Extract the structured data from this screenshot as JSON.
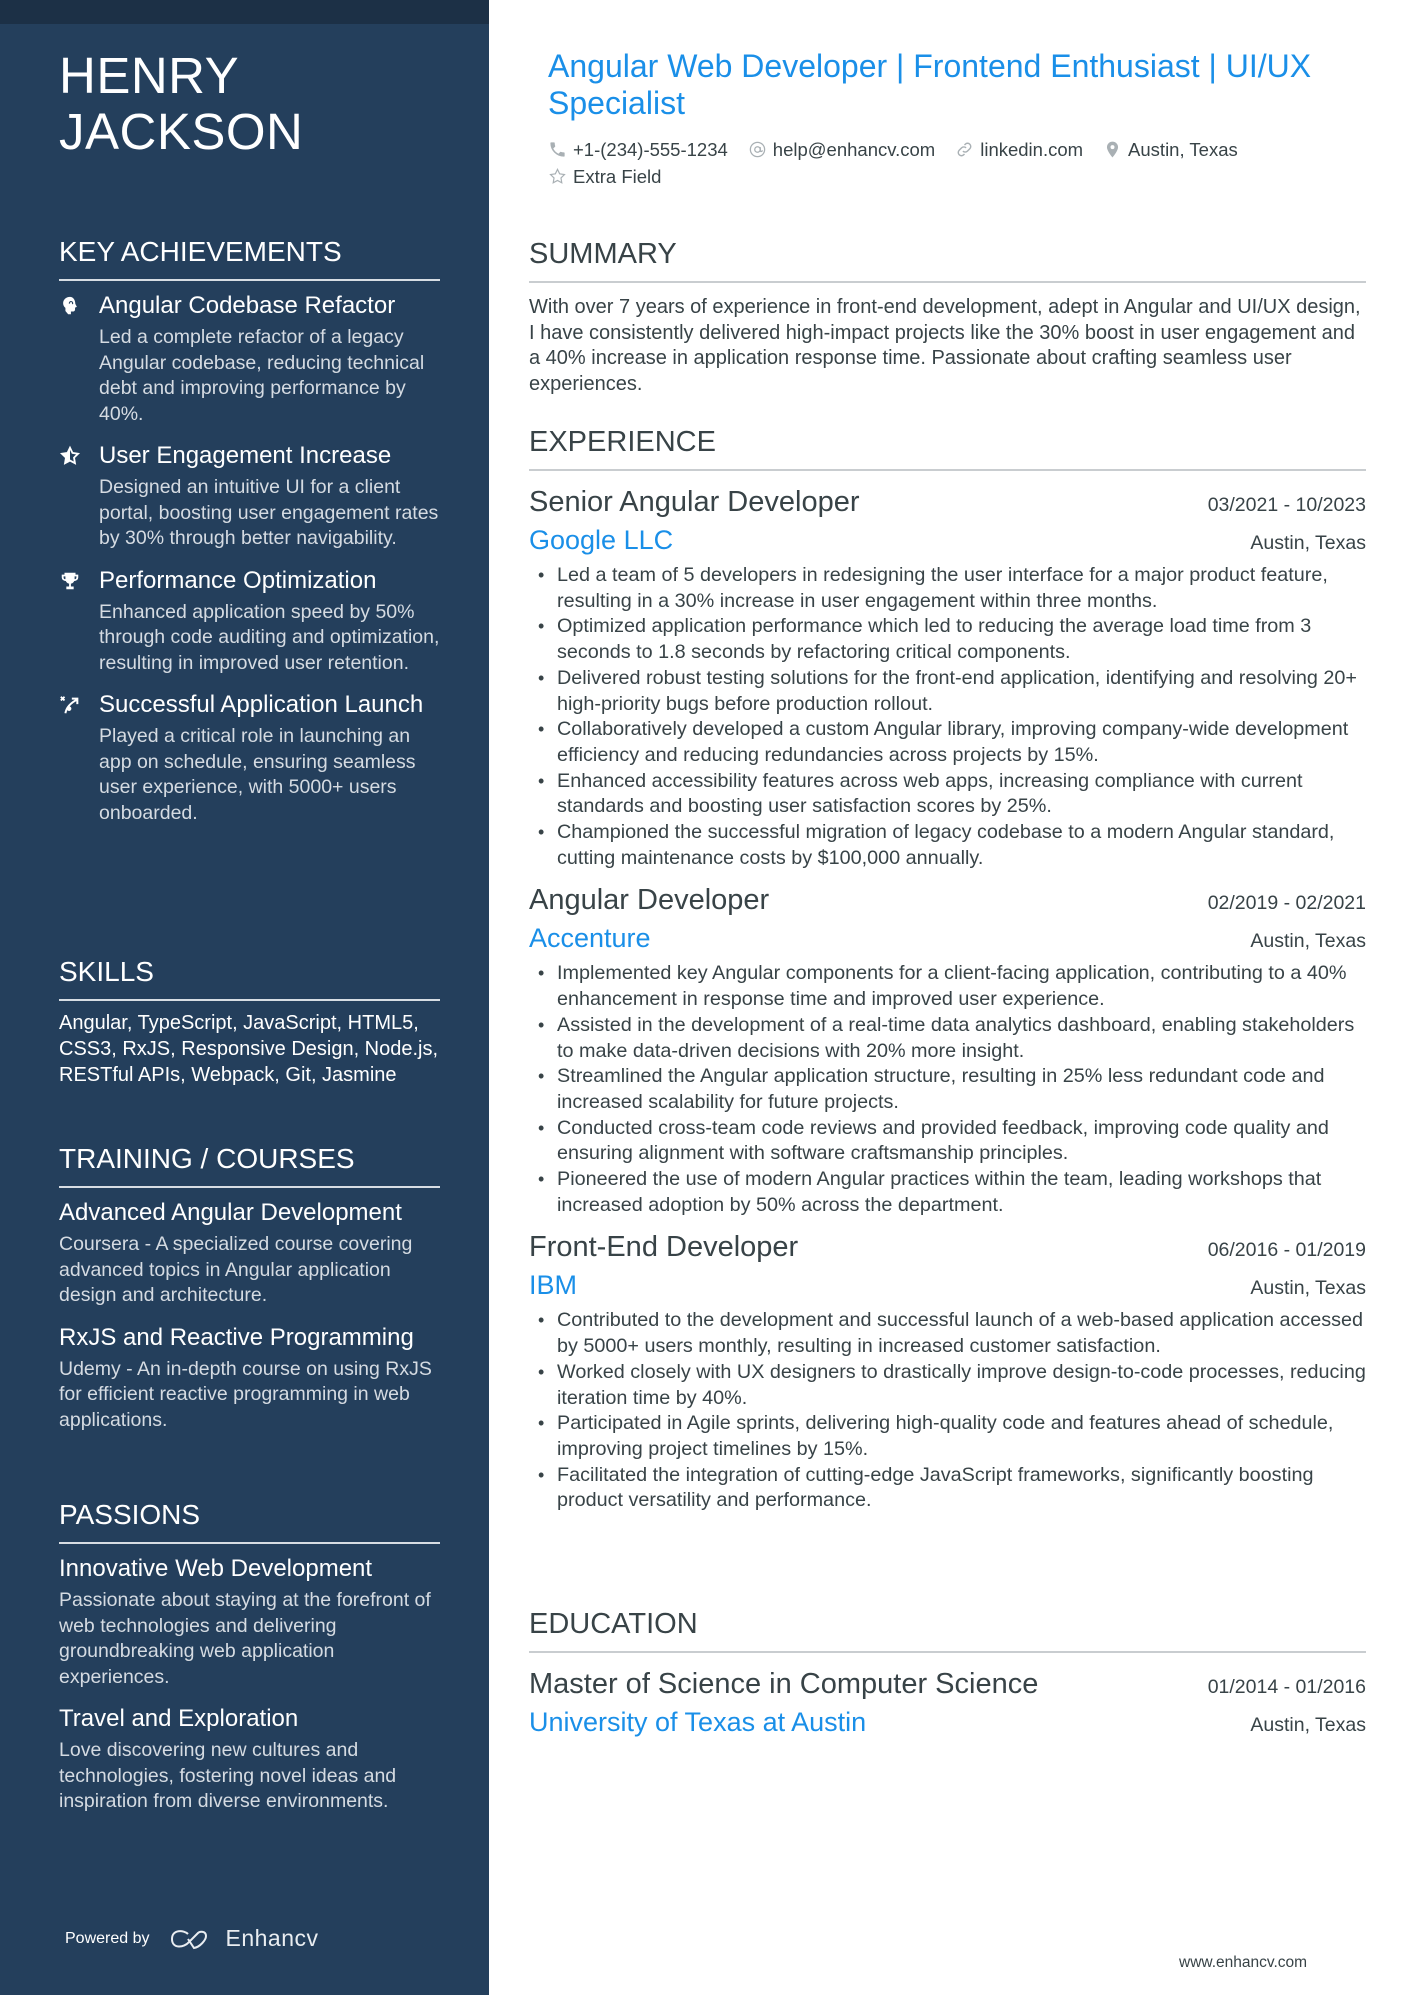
{
  "profile": {
    "first_name": "HENRY",
    "last_name": "JACKSON",
    "headline": "Angular Web Developer | Frontend Enthusiast | UI/UX Specialist",
    "contacts": [
      {
        "icon": "phone-icon",
        "text": "+1-(234)-555-1234"
      },
      {
        "icon": "at-icon",
        "text": "help@enhancv.com"
      },
      {
        "icon": "link-icon",
        "text": "linkedin.com"
      },
      {
        "icon": "location-pin-icon",
        "text": "Austin, Texas"
      }
    ],
    "extra": {
      "icon": "star-outline-icon",
      "text": "Extra Field"
    }
  },
  "sidebar": {
    "achievements": {
      "heading": "KEY ACHIEVEMENTS",
      "items": [
        {
          "icon": "head-brain-icon",
          "title": "Angular Codebase Refactor",
          "description": "Led a complete refactor of a legacy Angular codebase, reducing technical debt and improving performance by 40%."
        },
        {
          "icon": "star-half-icon",
          "title": "User Engagement Increase",
          "description": "Designed an intuitive UI for a client portal, boosting user engagement rates by 30% through better navigability."
        },
        {
          "icon": "trophy-icon",
          "title": "Performance Optimization",
          "description": "Enhanced application speed by 50% through code auditing and optimization, resulting in improved user retention."
        },
        {
          "icon": "route-launch-icon",
          "title": "Successful Application Launch",
          "description": "Played a critical role in launching an app on schedule, ensuring seamless user experience, with 5000+ users onboarded."
        }
      ]
    },
    "skills": {
      "heading": "SKILLS",
      "text": "Angular, TypeScript, JavaScript, HTML5, CSS3, RxJS, Responsive Design, Node.js, RESTful APIs, Webpack, Git, Jasmine"
    },
    "training": {
      "heading": "TRAINING / COURSES",
      "items": [
        {
          "title": "Advanced Angular Development",
          "description": "Coursera - A specialized course covering advanced topics in Angular application design and architecture."
        },
        {
          "title": "RxJS and Reactive Programming",
          "description": "Udemy - An in-depth course on using RxJS for efficient reactive programming in web applications."
        }
      ]
    },
    "passions": {
      "heading": "PASSIONS",
      "items": [
        {
          "title": "Innovative Web Development",
          "description": "Passionate about staying at the forefront of web technologies and delivering groundbreaking web application experiences."
        },
        {
          "title": "Travel and Exploration",
          "description": "Love discovering new cultures and technologies, fostering novel ideas and inspiration from diverse environments."
        }
      ]
    },
    "powered_by": {
      "label": "Powered by",
      "brand": "Enhancv"
    }
  },
  "main": {
    "summary": {
      "heading": "SUMMARY",
      "text": "With over 7 years of experience in front-end development, adept in Angular and UI/UX design, I have consistently delivered high-impact projects like the 30% boost in user engagement and a 40% increase in application response time. Passionate about crafting seamless user experiences."
    },
    "experience": {
      "heading": "EXPERIENCE",
      "jobs": [
        {
          "role": "Senior Angular Developer",
          "dates": "03/2021 - 10/2023",
          "company": "Google LLC",
          "location": "Austin, Texas",
          "bullets": [
            "Led a team of 5 developers in redesigning the user interface for a major product feature, resulting in a 30% increase in user engagement within three months.",
            "Optimized application performance which led to reducing the average load time from 3 seconds to 1.8 seconds by refactoring critical components.",
            "Delivered robust testing solutions for the front-end application, identifying and resolving 20+ high-priority bugs before production rollout.",
            "Collaboratively developed a custom Angular library, improving company-wide development efficiency and reducing redundancies across projects by 15%.",
            "Enhanced accessibility features across web apps, increasing compliance with current standards and boosting user satisfaction scores by 25%.",
            "Championed the successful migration of legacy codebase to a modern Angular standard, cutting maintenance costs by $100,000 annually."
          ]
        },
        {
          "role": "Angular Developer",
          "dates": "02/2019 - 02/2021",
          "company": "Accenture",
          "location": "Austin, Texas",
          "bullets": [
            "Implemented key Angular components for a client-facing application, contributing to a 40% enhancement in response time and improved user experience.",
            "Assisted in the development of a real-time data analytics dashboard, enabling stakeholders to make data-driven decisions with 20% more insight.",
            "Streamlined the Angular application structure, resulting in 25% less redundant code and increased scalability for future projects.",
            "Conducted cross-team code reviews and provided feedback, improving code quality and ensuring alignment with software craftsmanship principles.",
            "Pioneered the use of modern Angular practices within the team, leading workshops that increased adoption by 50% across the department."
          ]
        },
        {
          "role": "Front-End Developer",
          "dates": "06/2016 - 01/2019",
          "company": "IBM",
          "location": "Austin, Texas",
          "bullets": [
            "Contributed to the development and successful launch of a web-based application accessed by 5000+ users monthly, resulting in increased customer satisfaction.",
            "Worked closely with UX designers to drastically improve design-to-code processes, reducing iteration time by 40%.",
            "Participated in Agile sprints, delivering high-quality code and features ahead of schedule, improving project timelines by 15%.",
            "Facilitated the integration of cutting-edge JavaScript frameworks, significantly boosting product versatility and performance."
          ]
        }
      ]
    },
    "education": {
      "heading": "EDUCATION",
      "items": [
        {
          "degree": "Master of Science in Computer Science",
          "dates": "01/2014 - 01/2016",
          "school": "University of Texas at Austin",
          "location": "Austin, Texas"
        }
      ]
    }
  },
  "footer": {
    "url": "www.enhancv.com"
  },
  "colors": {
    "sidebar_bg": "#243f5c",
    "sidebar_top_band": "#1c3046",
    "accent": "#1a8fe8",
    "text": "#384347"
  }
}
